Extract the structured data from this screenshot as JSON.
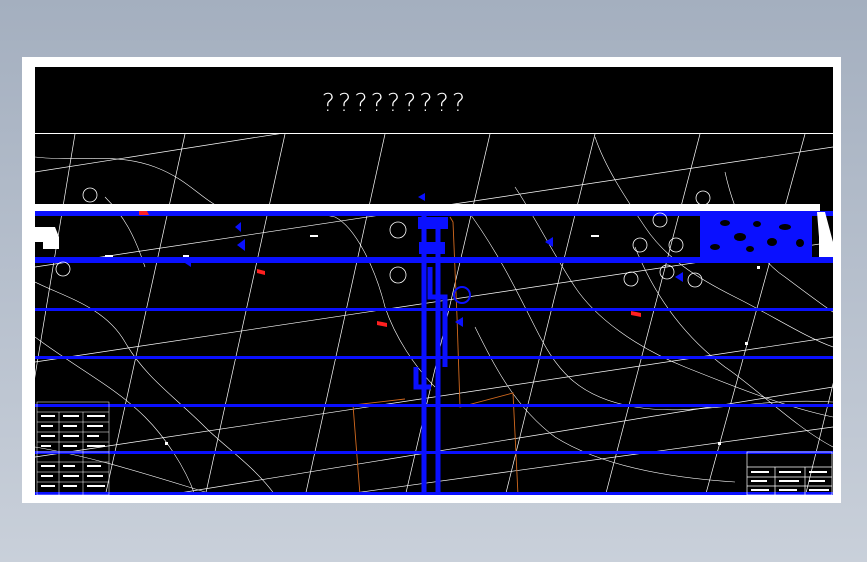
{
  "drawing": {
    "title": "?????????"
  },
  "colors": {
    "background": "#000000",
    "paper": "#ffffff",
    "pipe_blue": "#0a10ff",
    "contour_white": "#ffffff",
    "boundary_orange": "#d2691e",
    "marker_red": "#ff2020"
  }
}
